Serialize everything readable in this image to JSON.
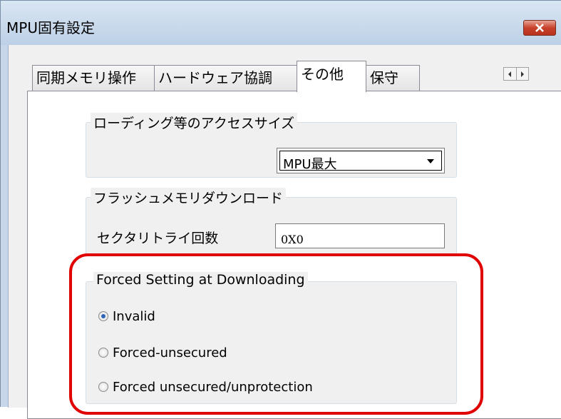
{
  "window": {
    "title": "MPU固有設定"
  },
  "tabs": [
    {
      "label": "同期メモリ操作"
    },
    {
      "label": "ハードウェア協調"
    },
    {
      "label": "その他"
    },
    {
      "label": "保守"
    }
  ],
  "access_size": {
    "group_label": "ローディング等のアクセスサイズ",
    "selected": "MPU最大"
  },
  "flash": {
    "group_label": "フラッシュメモリダウンロード",
    "retry_label": "セクタリトライ回数",
    "retry_value": "0X0"
  },
  "forced": {
    "group_label": "Forced Setting at Downloading",
    "options": [
      {
        "label": "Invalid",
        "checked": true
      },
      {
        "label": "Forced-unsecured",
        "checked": false
      },
      {
        "label": "Forced unsecured/unprotection",
        "checked": false
      }
    ]
  },
  "colors": {
    "highlight": "#e00000",
    "close_button": "#c7412b",
    "radio_selected": "#2d64b8"
  }
}
